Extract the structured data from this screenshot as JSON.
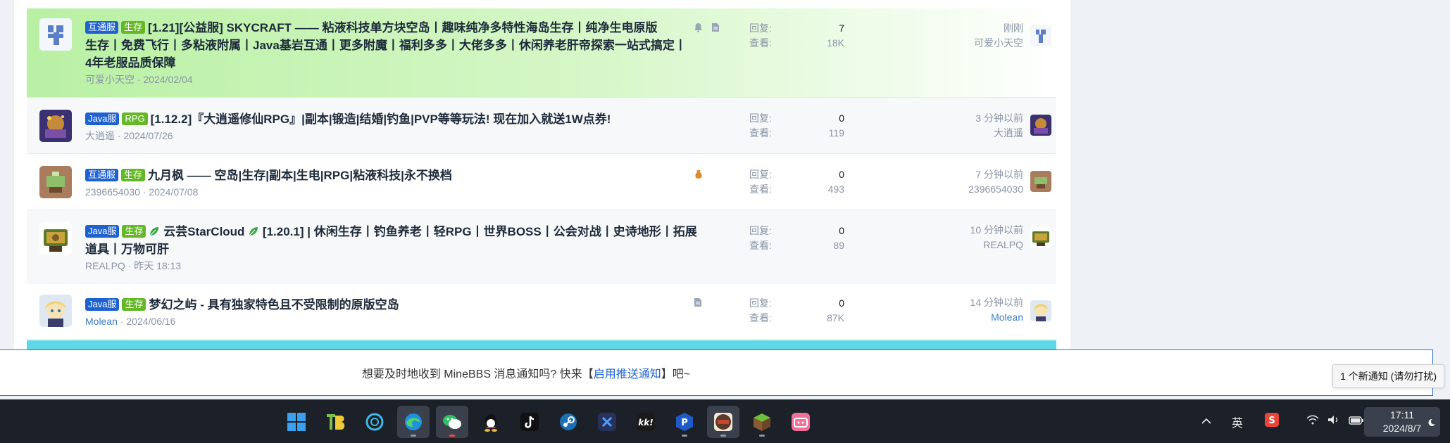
{
  "threads": [
    {
      "labels": [
        "互通服",
        "生存"
      ],
      "title_lines": [
        "[1.21][公益服] SKYCRAFT —— 粘液科技单方块空岛丨趣味纯净多特性海岛生存丨纯净生电原版",
        "生存丨免费飞行丨多粘液附属丨Java基岩互通丨更多附魔丨福利多多丨大佬多多丨休闲养老肝帝探索一站式搞定丨",
        "4年老服品质保障"
      ],
      "author": "可爱小天空",
      "date": "2024/02/04",
      "replies_label": "回复:",
      "replies": "7",
      "views_label": "查看:",
      "views": "18K",
      "latest_time": "刚刚",
      "latest_user": "可爱小天空"
    },
    {
      "labels": [
        "Java服",
        "RPG"
      ],
      "title_lines": [
        "[1.12.2]『大逍遥修仙RPG』|副本|锻造|结婚|钓鱼|PVP等等玩法!  现在加入就送1W点券!"
      ],
      "author": "大逍遥",
      "date": "2024/07/26",
      "replies_label": "回复:",
      "replies": "0",
      "views_label": "查看:",
      "views": "119",
      "latest_time": "3 分钟以前",
      "latest_user": "大逍遥"
    },
    {
      "labels": [
        "互通服",
        "生存"
      ],
      "title_lines": [
        "九月枫 —— 空岛|生存|副本|生电|RPG|粘液科技|永不换档"
      ],
      "author": "2396654030",
      "date": "2024/07/08",
      "replies_label": "回复:",
      "replies": "0",
      "views_label": "查看:",
      "views": "493",
      "latest_time": "7 分钟以前",
      "latest_user": "2396654030"
    },
    {
      "labels": [
        "Java服",
        "生存"
      ],
      "title_lines": [
        "云芸StarCloud",
        "[1.20.1] | 休闲生存丨钓鱼养老丨轻RPG丨世界BOSS丨公会对战丨史诗地形丨拓展",
        "道具丨万物可肝"
      ],
      "author": "REALPQ",
      "date": "昨天 18:13",
      "replies_label": "回复:",
      "replies": "0",
      "views_label": "查看:",
      "views": "89",
      "latest_time": "10 分钟以前",
      "latest_user": "REALPQ"
    },
    {
      "labels": [
        "Java服",
        "生存"
      ],
      "title_lines": [
        "梦幻之屿 - 具有独家特色且不受限制的原版空岛"
      ],
      "author": "Molean",
      "date": "2024/06/16",
      "replies_label": "回复:",
      "replies": "0",
      "views_label": "查看:",
      "views": "87K",
      "latest_time": "14 分钟以前",
      "latest_user": "Molean"
    }
  ],
  "notice": {
    "before": "想要及时地收到 MineBBS 消息通知吗? 快来【",
    "link": "启用推送通知",
    "after": "】吧~"
  },
  "toast": "1 个新通知 (请勿打扰)",
  "taskbar": {
    "ime": "英",
    "time": "17:11",
    "date": "2024/8/7"
  },
  "colors": {
    "accent": "#1e62d0",
    "label_green": "#64b827",
    "sticky_bg": "#b9f0a4",
    "taskbar_bg": "#1c2028"
  }
}
